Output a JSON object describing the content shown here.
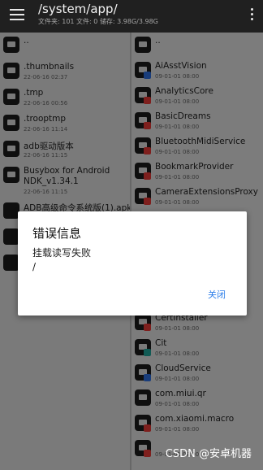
{
  "header": {
    "path": "/system/app/",
    "info": "文件夹: 101  文件: 0  储存: 3.98G/3.98G"
  },
  "left_pane": [
    {
      "name": "..",
      "date": "",
      "icon": "folder-icon"
    },
    {
      "name": ".thumbnails",
      "date": "22-06-16 02:37",
      "icon": "folder-icon"
    },
    {
      "name": ".tmp",
      "date": "22-06-16 00:56",
      "icon": "folder-icon"
    },
    {
      "name": ".trooptmp",
      "date": "22-06-16 11:14",
      "icon": "folder-icon"
    },
    {
      "name": "adb驱动版本",
      "date": "22-06-16 11:15",
      "icon": "folder-icon"
    },
    {
      "name": "Busybox for Android NDK_v1.34.1",
      "date": "22-06-16 11:15",
      "icon": "folder-icon"
    },
    {
      "name": "ADB高级命令系统版(1).apk",
      "date": "",
      "icon": "android-apk-icon"
    },
    {
      "name": "",
      "date": "",
      "icon": "video-file-icon"
    },
    {
      "name": "",
      "date": "",
      "icon": "video-file-icon"
    }
  ],
  "right_pane": [
    {
      "name": "..",
      "date": "",
      "badge": ""
    },
    {
      "name": "AiAsstVision",
      "date": "09-01-01 08:00",
      "badge": "blue"
    },
    {
      "name": "AnalyticsCore",
      "date": "09-01-01 08:00",
      "badge": "red"
    },
    {
      "name": "BasicDreams",
      "date": "09-01-01 08:00",
      "badge": "red"
    },
    {
      "name": "BluetoothMidiService",
      "date": "09-01-01 08:00",
      "badge": "red"
    },
    {
      "name": "BookmarkProvider",
      "date": "09-01-01 08:00",
      "badge": "red"
    },
    {
      "name": "CameraExtensionsProxy",
      "date": "09-01-01 08:00",
      "badge": "red"
    },
    {
      "name": "",
      "date": "",
      "badge": "red"
    },
    {
      "name": "",
      "date": "",
      "badge": "red"
    },
    {
      "name": "",
      "date": "",
      "badge": "red"
    },
    {
      "name": "",
      "date": "",
      "badge": "red"
    },
    {
      "name": "CertInstaller",
      "date": "09-01-01 08:00",
      "badge": "red"
    },
    {
      "name": "Cit",
      "date": "09-01-01 08:00",
      "badge": "teal"
    },
    {
      "name": "CloudService",
      "date": "09-01-01 08:00",
      "badge": "blue"
    },
    {
      "name": "com.miui.qr",
      "date": "09-01-01 08:00",
      "badge": ""
    },
    {
      "name": "com.xiaomi.macro",
      "date": "09-01-01 08:00",
      "badge": "red"
    },
    {
      "name": "",
      "date": "09-01-01 08:00",
      "badge": "red"
    }
  ],
  "dialog": {
    "title": "错误信息",
    "message": "挂载读写失败\n/",
    "close_label": "关闭"
  },
  "watermark": "CSDN @安卓机器"
}
